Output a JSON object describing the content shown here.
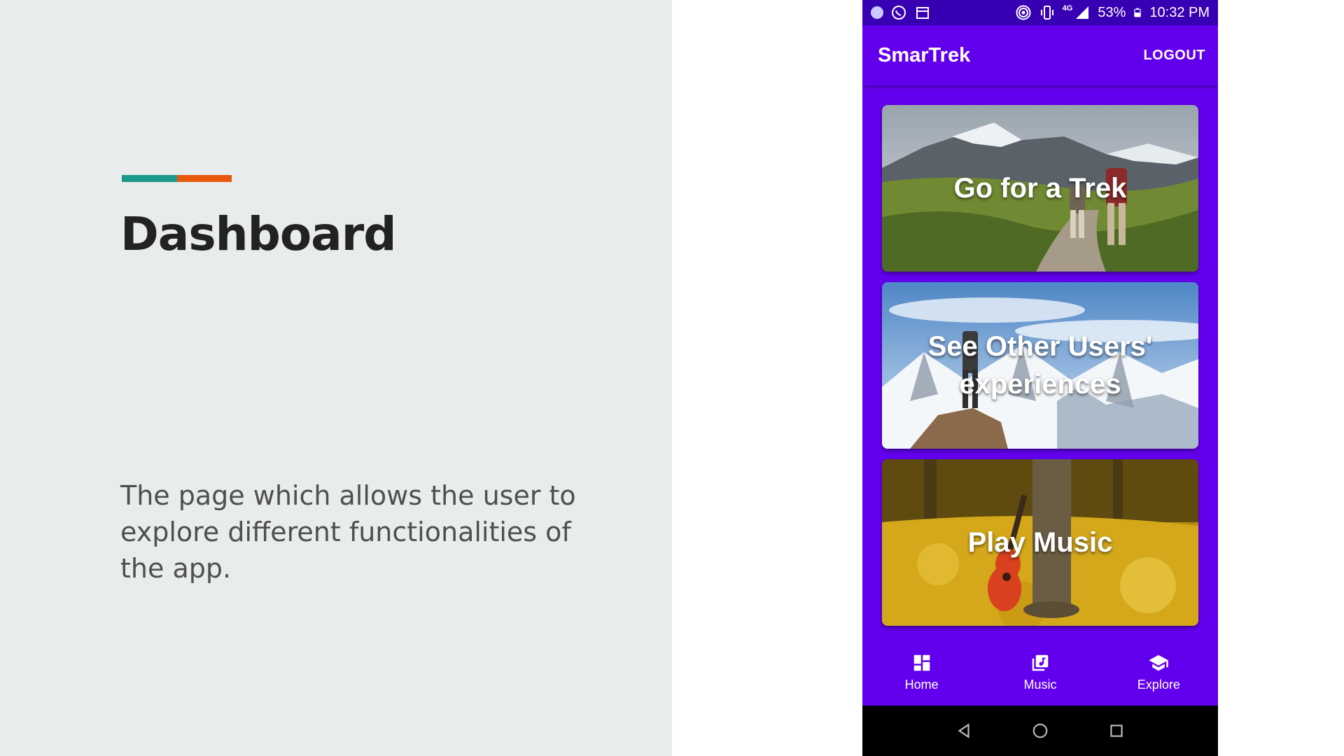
{
  "slide": {
    "title": "Dashboard",
    "description": "The page which allows the user to explore different functionalities of the app.",
    "accent_colors": [
      "#1a9a8b",
      "#e8590c"
    ]
  },
  "phone": {
    "status_bar": {
      "battery": "53%",
      "time": "10:32 PM",
      "network": "4G",
      "icons_left": [
        "notification-dot-icon",
        "whatsapp-icon",
        "calendar-icon"
      ],
      "icons_right": [
        "hotspot-icon",
        "vibrate-icon",
        "signal-icon",
        "battery-icon"
      ]
    },
    "app_bar": {
      "title": "SmarTrek",
      "logout_label": "LOGOUT",
      "color": "#6200ee"
    },
    "cards": [
      {
        "label": "Go for a Trek",
        "image": "mountain-trekkers-image"
      },
      {
        "label": "See Other Users' experiences",
        "image": "snowy-peak-hiker-image"
      },
      {
        "label": "Play Music",
        "image": "guitar-autumn-leaves-image"
      }
    ],
    "bottom_nav": [
      {
        "label": "Home",
        "icon": "dashboard-icon"
      },
      {
        "label": "Music",
        "icon": "music-library-icon"
      },
      {
        "label": "Explore",
        "icon": "school-icon"
      }
    ],
    "system_nav": [
      "back-icon",
      "home-circle-icon",
      "recents-square-icon"
    ]
  }
}
